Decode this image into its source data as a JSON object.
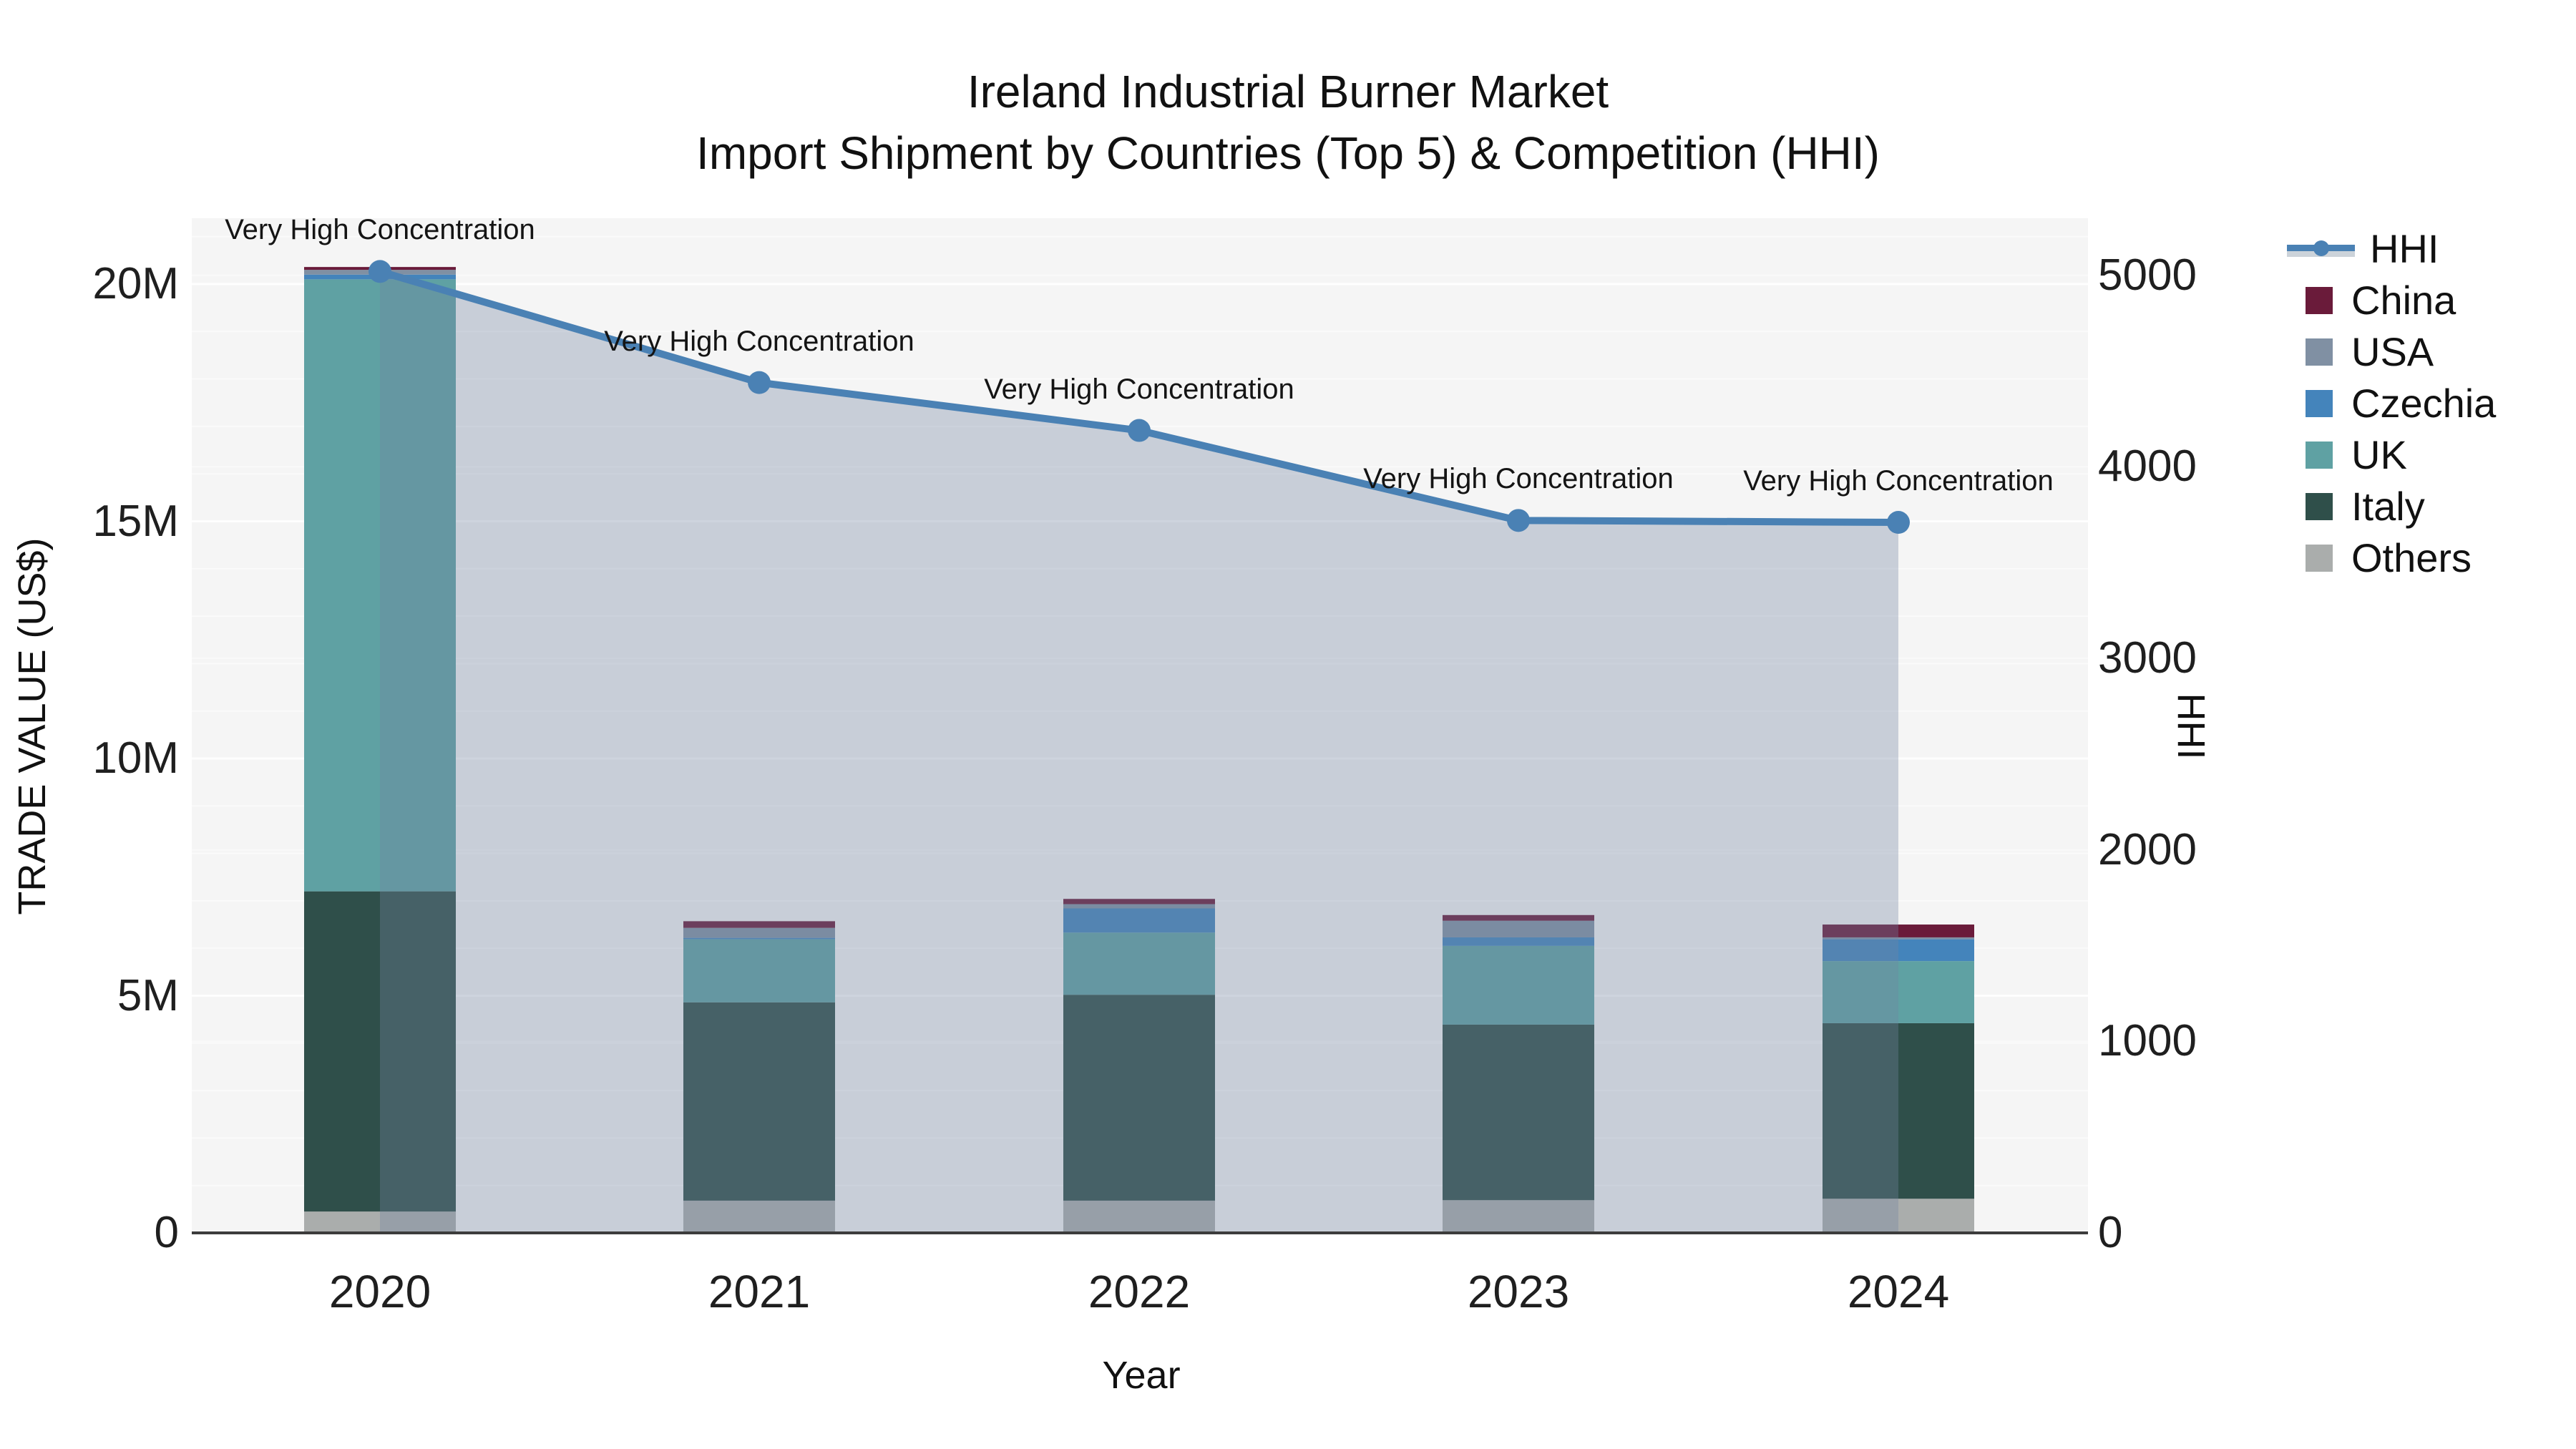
{
  "title": {
    "line1": "Ireland Industrial Burner Market",
    "line2": "Import Shipment by Countries (Top 5) & Competition (HHI)"
  },
  "axes": {
    "x": {
      "title": "Year",
      "ticks": [
        "2020",
        "2021",
        "2022",
        "2023",
        "2024"
      ]
    },
    "y_left": {
      "title": "TRADE VALUE (US$)",
      "ticks": [
        "0",
        "5M",
        "10M",
        "15M",
        "20M"
      ],
      "tick_values_millions": [
        0,
        5,
        10,
        15,
        20
      ],
      "range_millions": [
        0,
        21.4
      ]
    },
    "y_right": {
      "title": "HHI",
      "ticks": [
        "0",
        "1000",
        "2000",
        "3000",
        "4000",
        "5000"
      ],
      "tick_values": [
        0,
        1000,
        2000,
        3000,
        4000,
        5000
      ],
      "range": [
        0,
        5300
      ]
    }
  },
  "legend": {
    "items": [
      {
        "label": "HHI",
        "type": "line",
        "color": "#4a81b4"
      },
      {
        "label": "China",
        "type": "swatch",
        "color": "#6a1b3a"
      },
      {
        "label": "USA",
        "type": "swatch",
        "color": "#8090a3"
      },
      {
        "label": "Czechia",
        "type": "swatch",
        "color": "#4484bb"
      },
      {
        "label": "UK",
        "type": "swatch",
        "color": "#5fa1a3"
      },
      {
        "label": "Italy",
        "type": "swatch",
        "color": "#2f4f4a"
      },
      {
        "label": "Others",
        "type": "swatch",
        "color": "#aaadac"
      }
    ]
  },
  "chart_data": {
    "type": "bar",
    "subtype": "stacked bars (trade value, US$ millions) + line on secondary axis (HHI) with area fill",
    "categories": [
      "2020",
      "2021",
      "2022",
      "2023",
      "2024"
    ],
    "bar_unit": "million US$",
    "stack_order_bottom_to_top": [
      "Others",
      "Italy",
      "UK",
      "Czechia",
      "USA",
      "China"
    ],
    "series": [
      {
        "name": "Others",
        "color": "#aaadac",
        "values": [
          0.45,
          0.68,
          0.68,
          0.69,
          0.72
        ]
      },
      {
        "name": "Italy",
        "color": "#2f4f4a",
        "values": [
          6.75,
          4.18,
          4.34,
          3.7,
          3.7
        ]
      },
      {
        "name": "UK",
        "color": "#5fa1a3",
        "values": [
          12.9,
          1.33,
          1.31,
          1.66,
          1.31
        ]
      },
      {
        "name": "Czechia",
        "color": "#4484bb",
        "values": [
          0.1,
          0.03,
          0.51,
          0.18,
          0.46
        ]
      },
      {
        "name": "USA",
        "color": "#8090a3",
        "values": [
          0.1,
          0.21,
          0.09,
          0.35,
          0.04
        ]
      },
      {
        "name": "China",
        "color": "#6a1b3a",
        "values": [
          0.06,
          0.14,
          0.11,
          0.12,
          0.27
        ]
      }
    ],
    "line_series": {
      "name": "HHI",
      "color": "#4a81b4",
      "fill_color": "rgba(115,133,160,0.34)",
      "values": [
        5020,
        4440,
        4190,
        3720,
        3710
      ]
    },
    "annotations": [
      {
        "text": "Very High Concentration",
        "category": "2020"
      },
      {
        "text": "Very High Concentration",
        "category": "2021"
      },
      {
        "text": "Very High Concentration",
        "category": "2022"
      },
      {
        "text": "Very High Concentration",
        "category": "2023"
      },
      {
        "text": "Very High Concentration",
        "category": "2024"
      }
    ],
    "legend_position": "right",
    "grid": true,
    "plot_background": "#f5f5f5"
  }
}
